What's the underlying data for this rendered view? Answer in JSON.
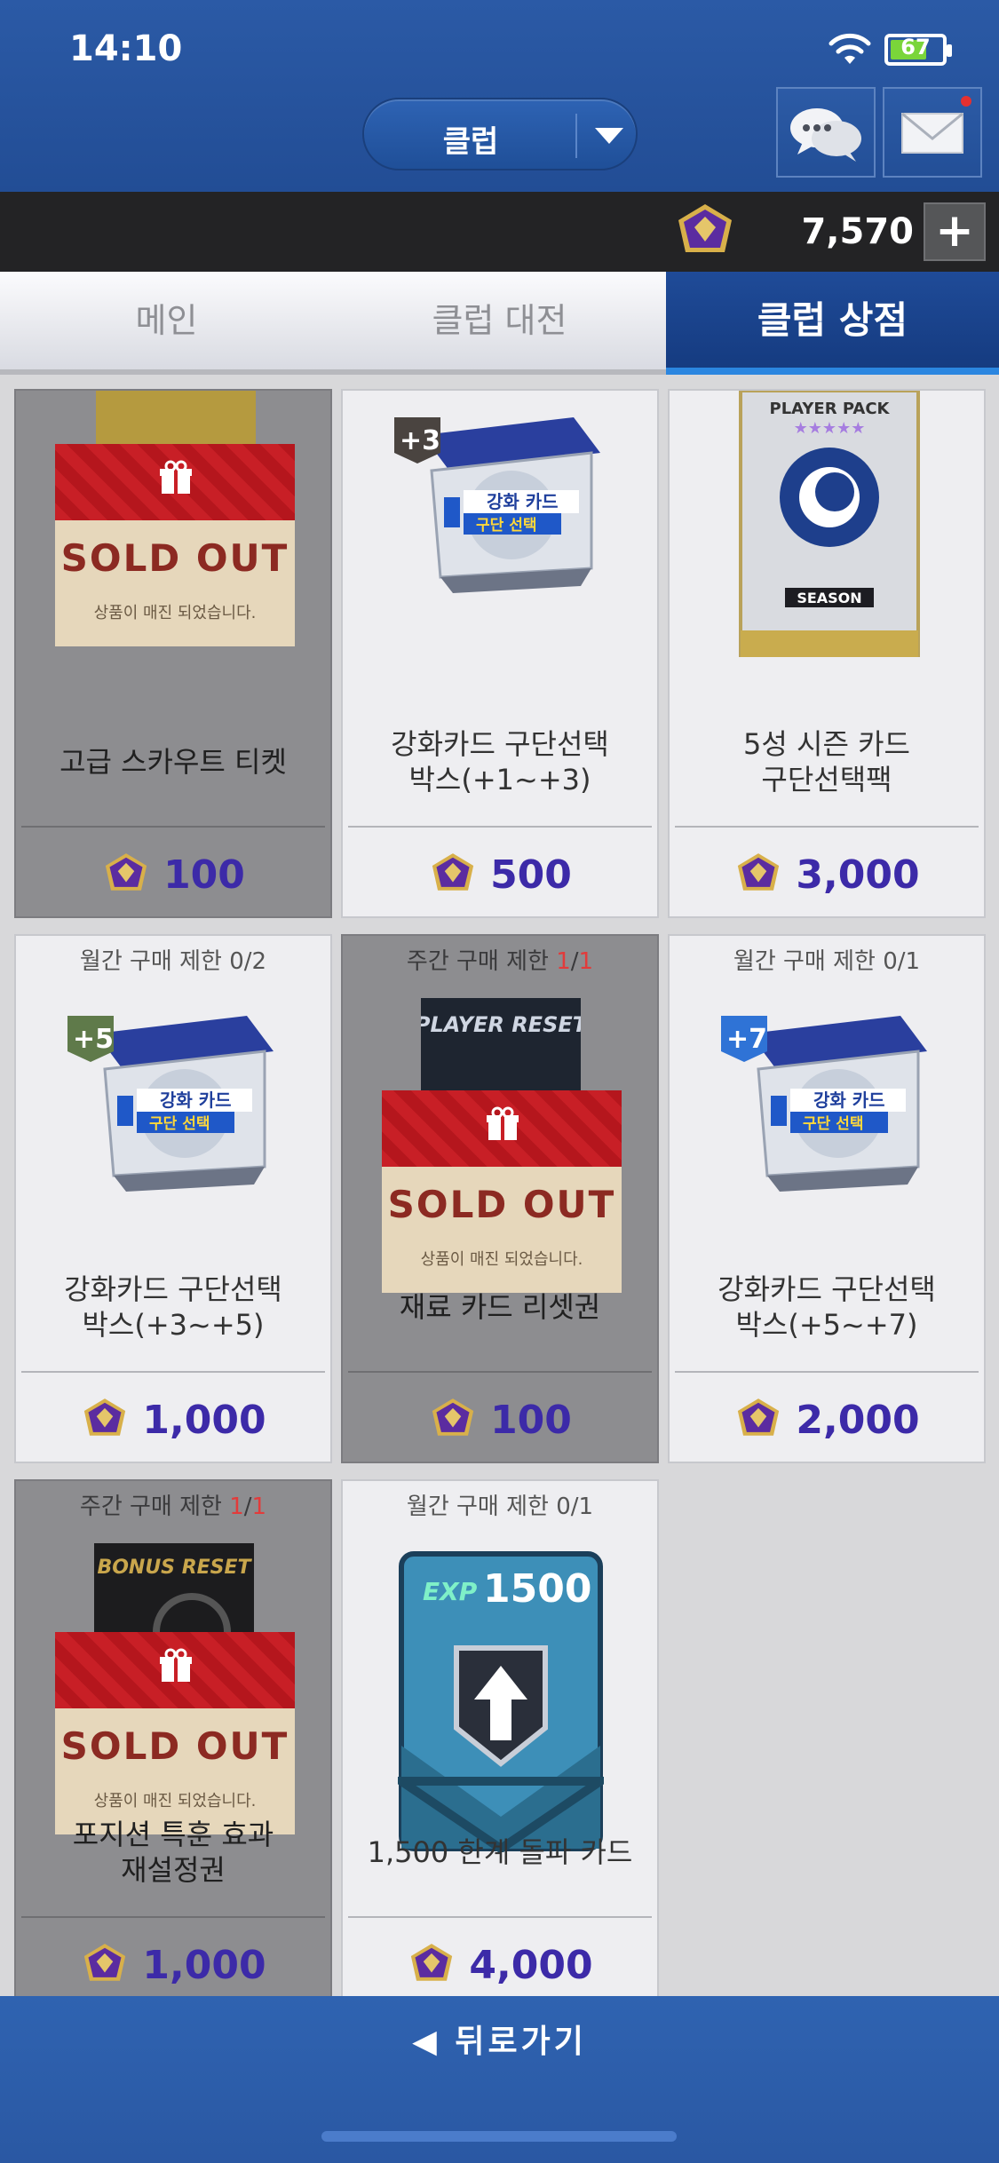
{
  "status_bar": {
    "time": "14:10",
    "battery": "67"
  },
  "header": {
    "club_selector": "클럽",
    "chat_icon": "chat-bubbles-icon",
    "mail_icon": "envelope-icon"
  },
  "currency": {
    "icon": "purple-gem-icon",
    "amount": "7,570",
    "add": "+"
  },
  "tabs": [
    {
      "label": "메인"
    },
    {
      "label": "클럽 대전"
    },
    {
      "label": "클럽 상점"
    }
  ],
  "items": [
    {
      "limit_prefix": "",
      "limit_used": "",
      "limit_max": "",
      "name": "고급 스카우트 티켓",
      "price": "100",
      "sold_out": true,
      "image": "scout-ticket"
    },
    {
      "limit_prefix": "",
      "limit_used": "",
      "limit_max": "",
      "name": "강화카드 구단선택\n박스(+1~+3)",
      "price": "500",
      "sold_out": false,
      "image": "enhance-box",
      "badge": "+3"
    },
    {
      "limit_prefix": "",
      "limit_used": "",
      "limit_max": "",
      "name": "5성 시즌 카드\n구단선택팩",
      "price": "3,000",
      "sold_out": false,
      "image": "player-pack"
    },
    {
      "limit_prefix": "월간 구매 제한 ",
      "limit_used": "0",
      "limit_max": "2",
      "name": "강화카드 구단선택\n박스(+3~+5)",
      "price": "1,000",
      "sold_out": false,
      "image": "enhance-box",
      "badge": "+5"
    },
    {
      "limit_prefix": "주간 구매 제한 ",
      "limit_used": "1",
      "limit_max": "1",
      "name": "재료 카드 리셋권",
      "price": "100",
      "sold_out": true,
      "image": "player-reset"
    },
    {
      "limit_prefix": "월간 구매 제한 ",
      "limit_used": "0",
      "limit_max": "1",
      "name": "강화카드 구단선택\n박스(+5~+7)",
      "price": "2,000",
      "sold_out": false,
      "image": "enhance-box",
      "badge": "+7"
    },
    {
      "limit_prefix": "주간 구매 제한 ",
      "limit_used": "1",
      "limit_max": "1",
      "name": "포지션 특훈 효과\n재설정권",
      "price": "1,000",
      "sold_out": true,
      "image": "bonus-reset"
    },
    {
      "limit_prefix": "월간 구매 제한 ",
      "limit_used": "0",
      "limit_max": "1",
      "name": "1,500 한계 돌파 카드",
      "price": "4,000",
      "sold_out": false,
      "image": "exp-card"
    }
  ],
  "labels": {
    "enhance_card": "강화 카드",
    "team_select": "구단 선택",
    "player_pack": "PLAYER PACK",
    "season": "SEASON",
    "player_reset": "PLAYER RESET",
    "bonus_reset": "BONUS RESET",
    "exp": "EXP",
    "exp_value": "1500",
    "sold_out": "SOLD OUT",
    "sold_out_sub": "상품이 매진 되었습니다."
  },
  "footer": {
    "back": "뒤로가기"
  },
  "colors": {
    "header_blue": "#2b5aa6",
    "active_tab": "#1f4b98",
    "price_text": "#3c2aa8",
    "gem_purple": "#5b2ca0",
    "gem_gold": "#d8b04a",
    "limit_red": "#e23b3b"
  }
}
